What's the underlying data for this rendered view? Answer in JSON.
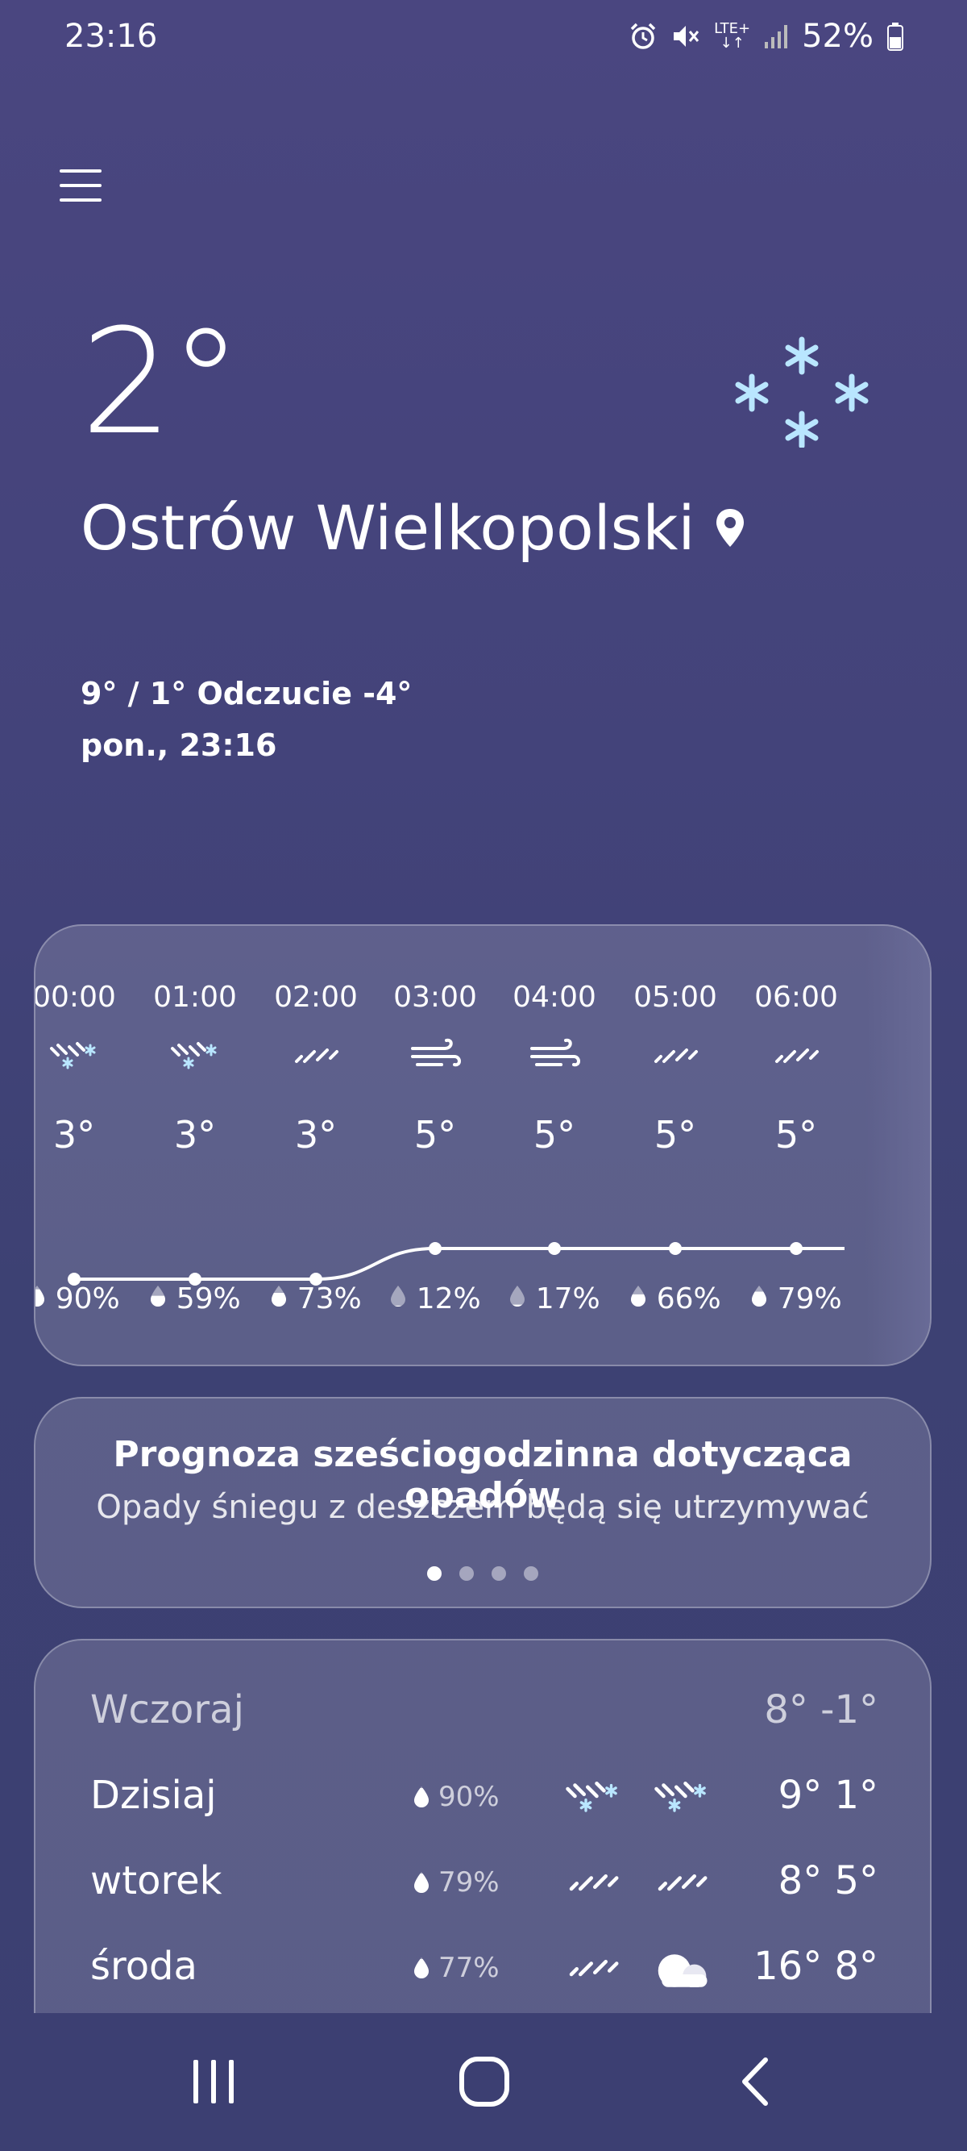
{
  "status_bar": {
    "time": "23:16",
    "battery": "52%",
    "network": "LTE+"
  },
  "current": {
    "temperature": "2°",
    "location": "Ostrów Wielkopolski",
    "range_feels": "9° / 1° Odczucie -4°",
    "datetime": "pon., 23:16"
  },
  "hourly": [
    {
      "time": "00:00",
      "icon": "snow-rain-icon",
      "temp": "3°",
      "precip": "90%",
      "precip_level": 0.9
    },
    {
      "time": "01:00",
      "icon": "snow-rain-icon",
      "temp": "3°",
      "precip": "59%",
      "precip_level": 0.59
    },
    {
      "time": "02:00",
      "icon": "rain-icon",
      "temp": "3°",
      "precip": "73%",
      "precip_level": 0.73
    },
    {
      "time": "03:00",
      "icon": "wind-icon",
      "temp": "5°",
      "precip": "12%",
      "precip_level": 0.12
    },
    {
      "time": "04:00",
      "icon": "wind-icon",
      "temp": "5°",
      "precip": "17%",
      "precip_level": 0.17
    },
    {
      "time": "05:00",
      "icon": "rain-icon",
      "temp": "5°",
      "precip": "66%",
      "precip_level": 0.66
    },
    {
      "time": "06:00",
      "icon": "rain-icon",
      "temp": "5°",
      "precip": "79%",
      "precip_level": 0.79
    }
  ],
  "precip_forecast": {
    "title": "Prognoza sześciogodzinna dotycząca opadów",
    "subtitle": "Opady śniegu z deszczem będą się utrzymywać",
    "page_count": 4,
    "active_page": 0
  },
  "daily": [
    {
      "day": "Wczoraj",
      "prob": "",
      "icon_day": "",
      "icon_night": "",
      "range": "8° -1°",
      "muted": true
    },
    {
      "day": "Dzisiaj",
      "prob": "90%",
      "icon_day": "snow-rain-icon",
      "icon_night": "snow-rain-icon",
      "range": "9° 1°",
      "muted": false
    },
    {
      "day": "wtorek",
      "prob": "79%",
      "icon_day": "rain-icon",
      "icon_night": "rain-icon",
      "range": "8° 5°",
      "muted": false
    },
    {
      "day": "środa",
      "prob": "77%",
      "icon_day": "rain-icon",
      "icon_night": "cloud-icon",
      "range": "16° 8°",
      "muted": false
    }
  ],
  "colors": {
    "snow_accent": "#b9e6ff",
    "card_bg": "rgba(255,255,255,0.16)"
  }
}
